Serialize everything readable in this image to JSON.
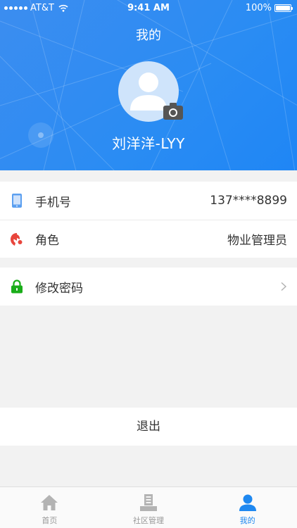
{
  "status_bar": {
    "carrier": "AT&T",
    "time": "9:41 AM",
    "battery": "100%"
  },
  "header": {
    "title": "我的",
    "user_name": "刘洋洋-LYY"
  },
  "info": {
    "phone_label": "手机号",
    "phone_value": "137****8899",
    "role_label": "角色",
    "role_value": "物业管理员"
  },
  "security": {
    "change_password_label": "修改密码"
  },
  "logout_label": "退出",
  "tabs": [
    {
      "label": "首页",
      "icon": "home-icon",
      "active": false
    },
    {
      "label": "社区管理",
      "icon": "building-icon",
      "active": false
    },
    {
      "label": "我的",
      "icon": "person-icon",
      "active": true
    }
  ],
  "colors": {
    "accent": "#1e88f0",
    "header_bg": "#2a8cf3",
    "lock_green": "#1aad19",
    "role_red": "#e8453c"
  }
}
